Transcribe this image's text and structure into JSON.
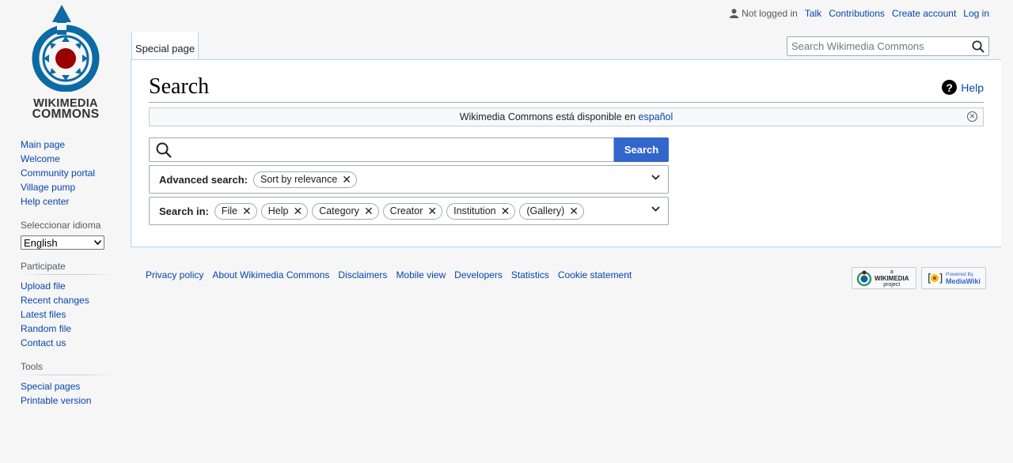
{
  "personal": {
    "not_logged_in": "Not logged in",
    "talk": "Talk",
    "contributions": "Contributions",
    "create_account": "Create account",
    "log_in": "Log in"
  },
  "logo": {
    "line1": "WIKIMEDIA",
    "line2": "COMMONS"
  },
  "sidebar": {
    "nav": [
      "Main page",
      "Welcome",
      "Community portal",
      "Village pump",
      "Help center"
    ],
    "language_heading": "Seleccionar idioma",
    "language_value": "English",
    "participate_heading": "Participate",
    "participate": [
      "Upload file",
      "Recent changes",
      "Latest files",
      "Random file",
      "Contact us"
    ],
    "tools_heading": "Tools",
    "tools": [
      "Special pages",
      "Printable version"
    ]
  },
  "tabs": {
    "special_page": "Special page"
  },
  "header_search": {
    "placeholder": "Search Wikimedia Commons"
  },
  "main": {
    "title": "Search",
    "help_label": "Help",
    "lang_notice_text": "Wikimedia Commons está disponible en ",
    "lang_notice_link": "español",
    "search_button": "Search",
    "advanced_label": "Advanced search:",
    "advanced_chips": [
      "Sort by relevance"
    ],
    "search_in_label": "Search in:",
    "search_in_chips": [
      "File",
      "Help",
      "Category",
      "Creator",
      "Institution",
      "(Gallery)"
    ]
  },
  "footer": {
    "links": [
      "Privacy policy",
      "About Wikimedia Commons",
      "Disclaimers",
      "Mobile view",
      "Developers",
      "Statistics",
      "Cookie statement"
    ],
    "wikimedia_badge_top": "a",
    "wikimedia_badge_main": "WIKIMEDIA",
    "wikimedia_badge_sub": "project",
    "mediawiki_badge_top": "Powered By",
    "mediawiki_badge_main": "MediaWiki"
  },
  "colors": {
    "link": "#0645ad",
    "primary_button": "#3366cc",
    "logo_blue": "#0c6aa4",
    "logo_red": "#990000"
  }
}
